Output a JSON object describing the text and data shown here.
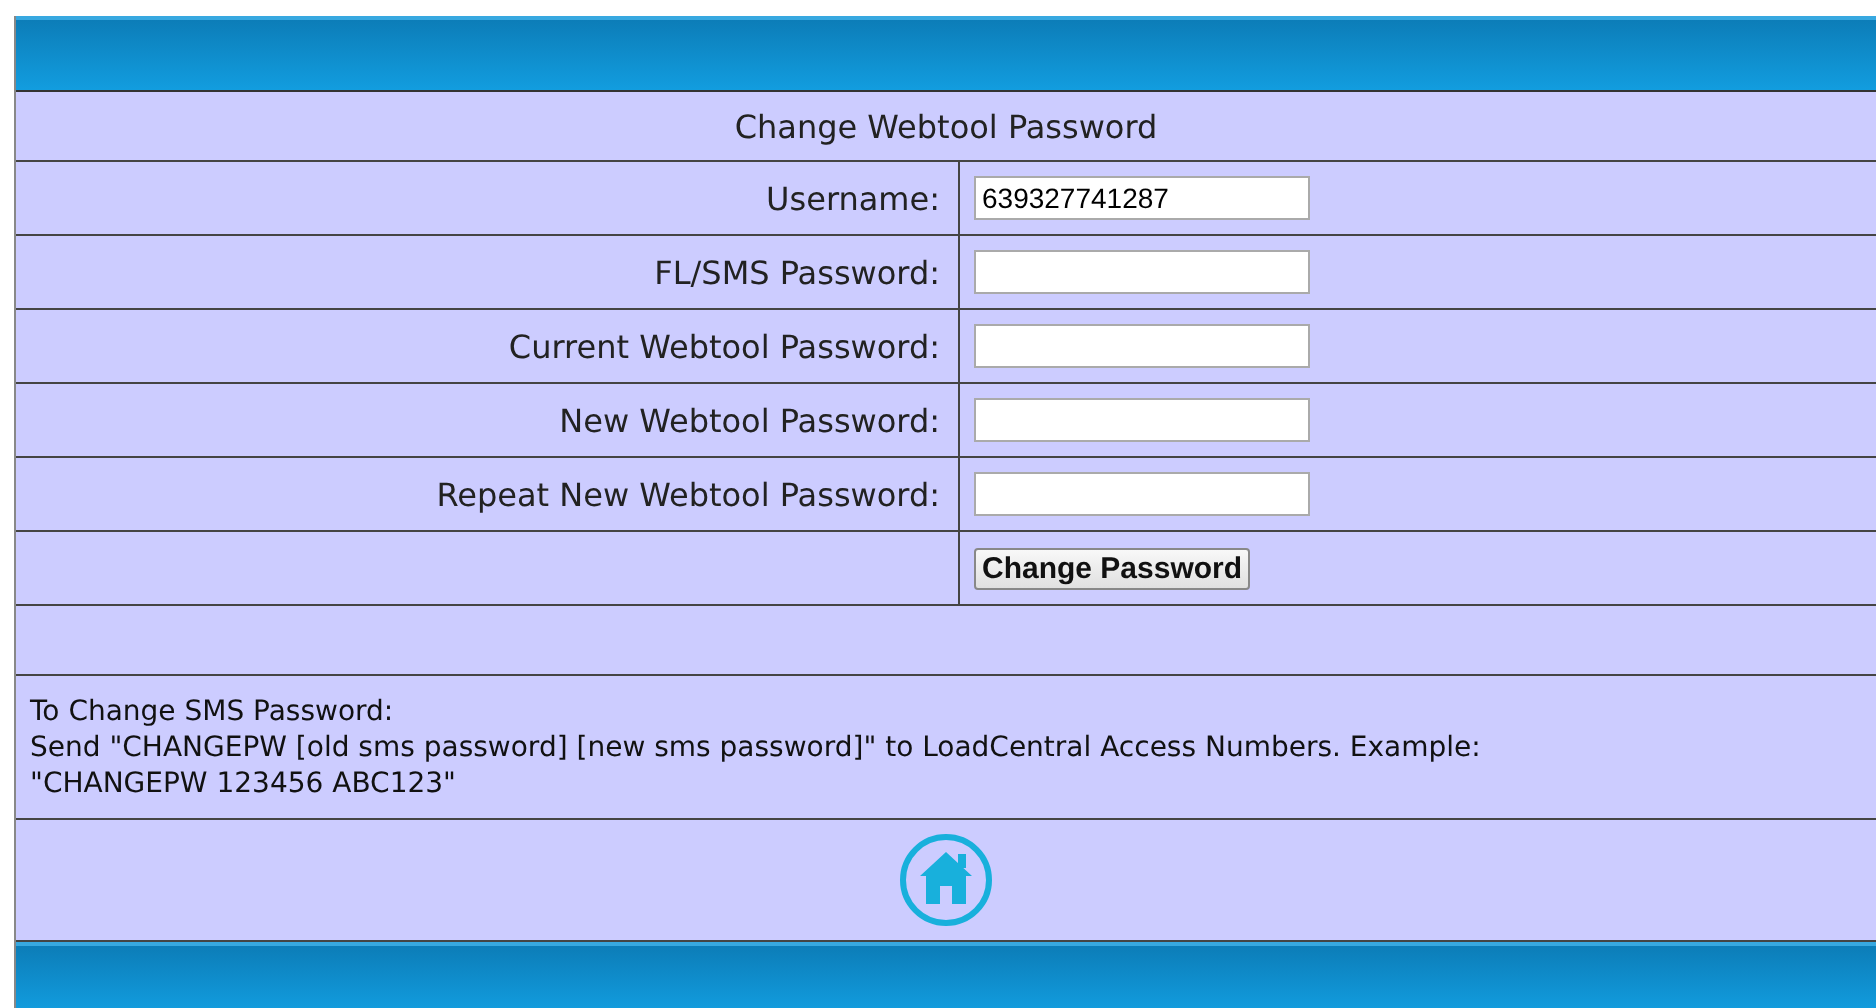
{
  "form": {
    "title": "Change Webtool Password",
    "fields": [
      {
        "label": "Username:",
        "value": "639327741287"
      },
      {
        "label": "FL/SMS Password:"
      },
      {
        "label": "Current Webtool Password:"
      },
      {
        "label": "New Webtool Password:"
      },
      {
        "label": "Repeat New Webtool Password:"
      }
    ],
    "submit_button": "Change Password"
  },
  "note": {
    "heading": "To Change SMS Password:",
    "lines": [
      "Send \"CHANGEPW [old sms password] [new sms password]\" to LoadCentral Access Numbers. Example:",
      "\"CHANGEPW 123456 ABC123\""
    ]
  }
}
